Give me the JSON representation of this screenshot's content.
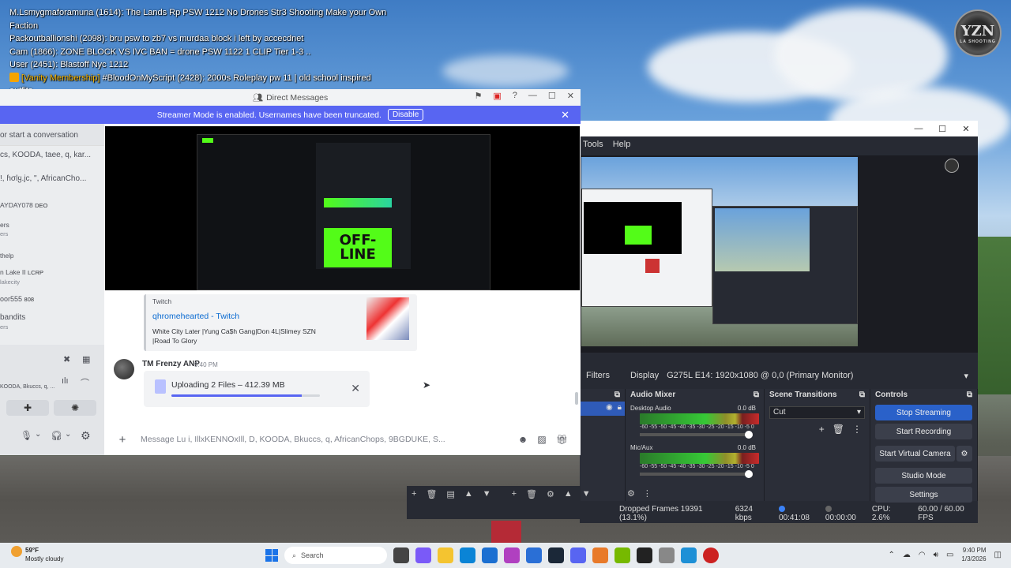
{
  "chat_overlay": {
    "lines": [
      "M.Lsmygmaforamuna (1614): The Lands Rp PSW 1212 No Drones Str3 Shooting Make your Own",
      "Faction",
      "Packoutballionshi (2098): bru psw to zb7 vs murdaa block i left by accecdnet",
      "Cam (1866): ZONE BLOCK VS IVC BAN = drone PSW 1122 1 CLIP Tier 1-3 ..",
      "User (2451): Blastoff Nyc 1212"
    ],
    "vip_badge": "[Vanity Membership]",
    "vip_message": "#BloodOnMyScript (2428): 2000s Roleplay pw 11 | old school inspired",
    "vip_cont": "outfits"
  },
  "logo": {
    "text": "YZN",
    "sub": "LA SHOOTING"
  },
  "discord": {
    "title": "Direct Messages",
    "banner_text": "Streamer Mode is enabled. Usernames have been truncated.",
    "banner_button": "Disable",
    "sidebar": {
      "search": "or start a conversation",
      "items": [
        {
          "name": "cs, KOODA, taee, q, kar...",
          "sub": ""
        },
        {
          "name": "!, ɦσlყ.jc, \", AfricanCho...",
          "sub": ""
        },
        {
          "name": "AYDAY078",
          "tag": "DEO"
        },
        {
          "name": "ers",
          "sub": "ers"
        },
        {
          "name": "thelp",
          "sub": ""
        },
        {
          "name": "n Lake II",
          "tag": "LCRP"
        },
        {
          "name": "",
          "sub": "lakecity"
        },
        {
          "name": "oor555",
          "tag": "808"
        },
        {
          "name": "bandits",
          "sub": "ers"
        }
      ],
      "user_sub": "KOODA, Bkuccs, q, ..."
    },
    "embed": {
      "provider": "Twitch",
      "title": "qhromehearted - Twitch",
      "desc_line1": "White City Later |Yung Ca$h Gang|Don 4L|Slimey SZN",
      "desc_line2": "|Road To Glory"
    },
    "message": {
      "author": "TM Frenzy ANP",
      "time": "9:40 PM",
      "upload_label": "Uploading 2 Files",
      "upload_size": "412.39 MB",
      "upload_progress": 0.88
    },
    "composer_placeholder": "Message Lu i, IllxKENNOxIll, D, KOODA, Bkuccs, q, AfricanChops, 9BGDUKE, S...",
    "stream_preview": {
      "offline_text": "OFF-LINE"
    }
  },
  "obs": {
    "menu": [
      "Tools",
      "Help"
    ],
    "filters_label": "Filters",
    "display_label": "Display",
    "display_value": "G275L E14: 1920x1080 @ 0,0 (Primary Monitor)",
    "docks": {
      "mixer_title": "Audio Mixer",
      "transitions_title": "Scene Transitions",
      "controls_title": "Controls"
    },
    "channels": [
      {
        "name": "Desktop Audio",
        "db": "0.0 dB"
      },
      {
        "name": "Mic/Aux",
        "db": "0.0 dB"
      }
    ],
    "meter_scale": "-60 -55 -50 -45 -40 -35 -30 -25 -20 -15 -10 -5 0",
    "transition": "Cut",
    "controls": [
      "Stop Streaming",
      "Start Recording",
      "Start Virtual Camera",
      "Studio Mode",
      "Settings"
    ],
    "status": {
      "dropped": "Dropped Frames 19391 (13.1%)",
      "bitrate": "6324 kbps",
      "stream_time": "00:41:08",
      "rec_time": "00:00:00",
      "cpu": "CPU: 2.6%",
      "fps": "60.00 / 60.00 FPS"
    }
  },
  "taskbar": {
    "temp": "59°F",
    "weather": "Mostly cloudy",
    "search": "Search",
    "time": "9:40 PM",
    "date": "1/3/2026"
  }
}
